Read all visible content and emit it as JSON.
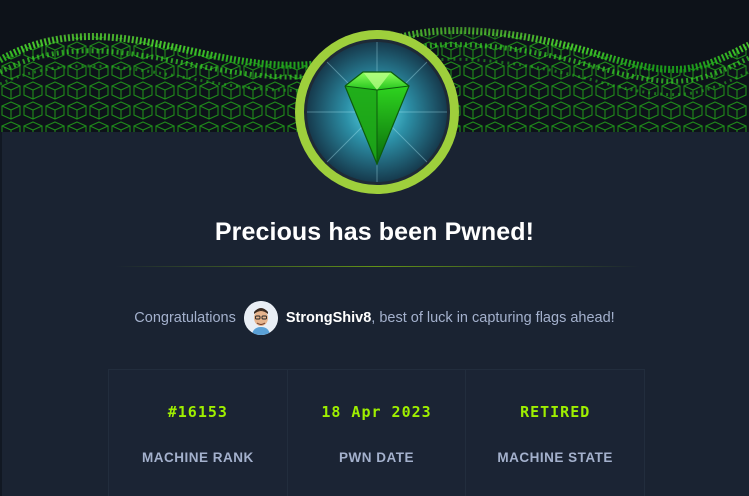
{
  "page": {
    "title": "Precious has been Pwned!",
    "accent_color": "#9fef00",
    "background_color": "#1a2332"
  },
  "congrats": {
    "lead": "Congratulations",
    "username": "StrongShiv8",
    "trailer": ", best of luck in capturing flags ahead!",
    "avatar_icon": "memoji-avatar"
  },
  "badge": {
    "icon": "green-gem-icon"
  },
  "stats": [
    {
      "value": "#16153",
      "label": "MACHINE RANK"
    },
    {
      "value": "18 Apr 2023",
      "label": "PWN DATE"
    },
    {
      "value": "RETIRED",
      "label": "MACHINE STATE"
    }
  ]
}
